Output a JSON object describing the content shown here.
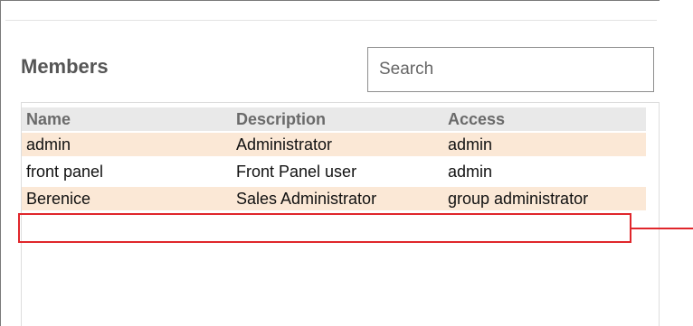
{
  "panel": {
    "title": "Members"
  },
  "search": {
    "placeholder": "Search",
    "value": ""
  },
  "table": {
    "columns": [
      "Name",
      "Description",
      "Access"
    ],
    "rows": [
      {
        "name": "admin",
        "description": "Administrator",
        "access": "admin"
      },
      {
        "name": "front panel",
        "description": "Front Panel user",
        "access": "admin"
      },
      {
        "name": "Berenice",
        "description": "Sales Administrator",
        "access": "group administrator"
      }
    ]
  },
  "colors": {
    "row_highlight": "#fbe8d6",
    "header_bg": "#e9e9e9",
    "annotation": "#e0262b"
  }
}
